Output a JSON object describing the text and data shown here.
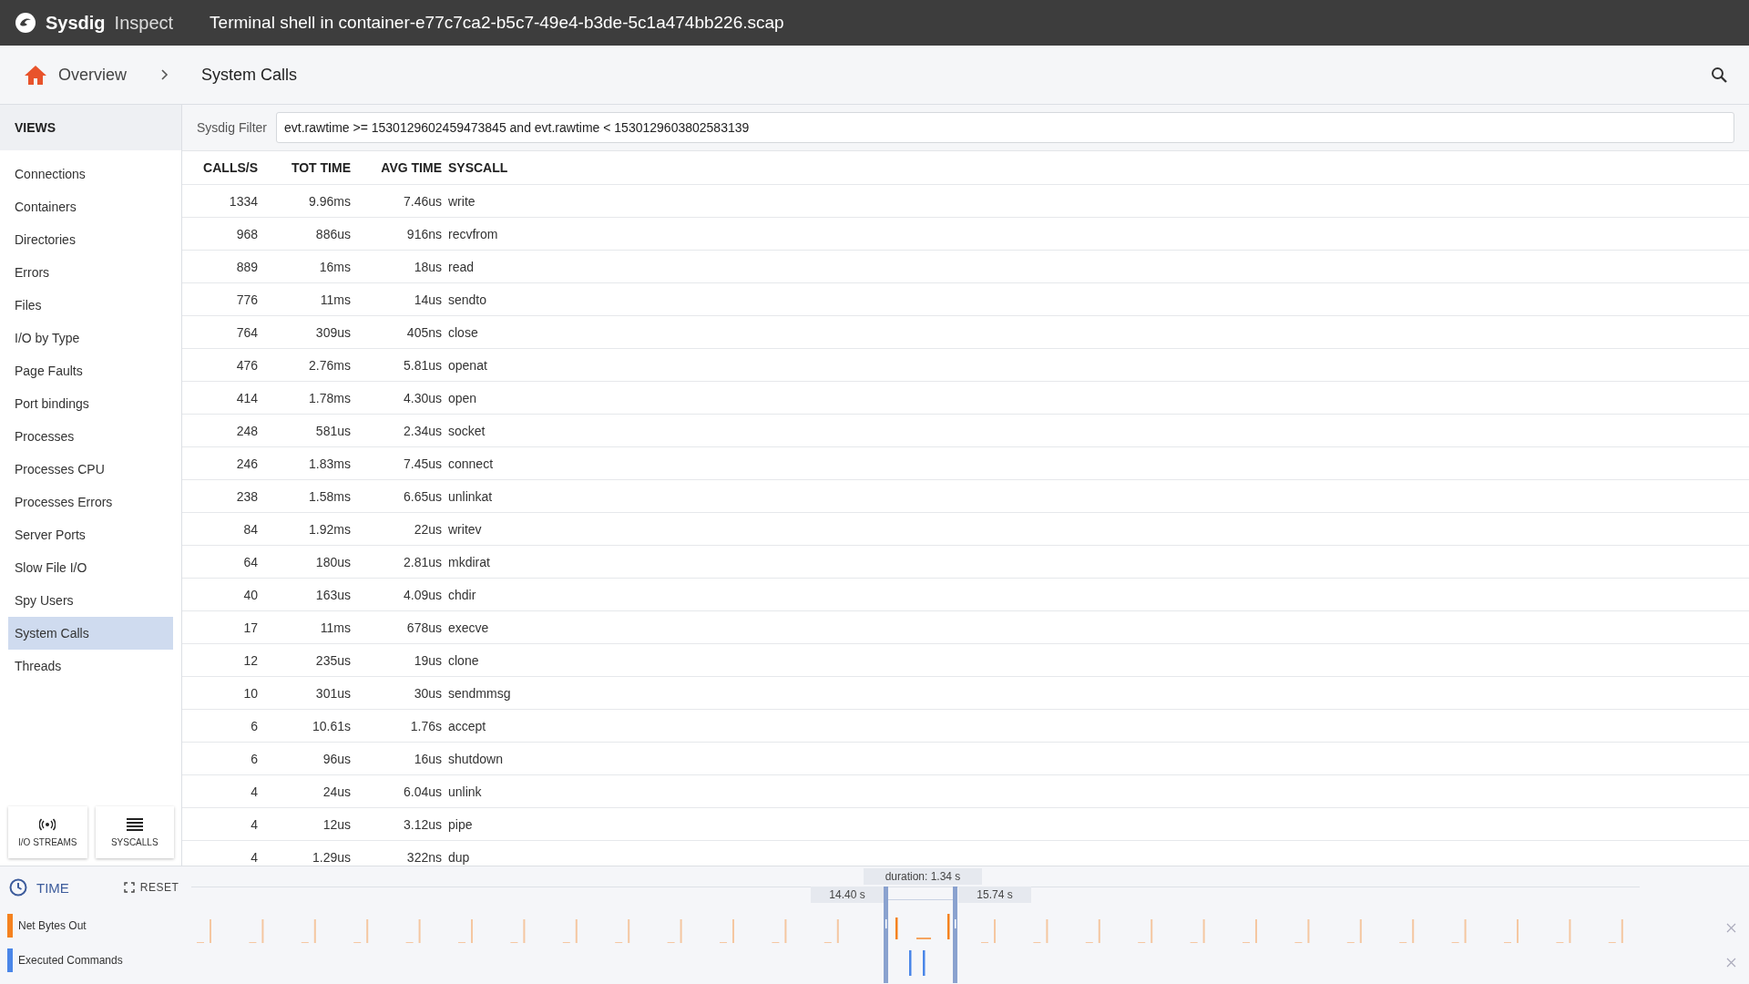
{
  "app": {
    "brand": "Sysdig",
    "product": "Inspect",
    "title": "Terminal shell in container-e77c7ca2-b5c7-49e4-b3de-5c1a474bb226.scap"
  },
  "breadcrumb": [
    "Overview",
    "System Calls"
  ],
  "sidebar": {
    "header": "VIEWS",
    "items": [
      {
        "label": "Connections",
        "selected": false
      },
      {
        "label": "Containers",
        "selected": false
      },
      {
        "label": "Directories",
        "selected": false
      },
      {
        "label": "Errors",
        "selected": false
      },
      {
        "label": "Files",
        "selected": false
      },
      {
        "label": "I/O by Type",
        "selected": false
      },
      {
        "label": "Page Faults",
        "selected": false
      },
      {
        "label": "Port bindings",
        "selected": false
      },
      {
        "label": "Processes",
        "selected": false
      },
      {
        "label": "Processes CPU",
        "selected": false
      },
      {
        "label": "Processes Errors",
        "selected": false
      },
      {
        "label": "Server Ports",
        "selected": false
      },
      {
        "label": "Slow File I/O",
        "selected": false
      },
      {
        "label": "Spy Users",
        "selected": false
      },
      {
        "label": "System Calls",
        "selected": true
      },
      {
        "label": "Threads",
        "selected": false
      }
    ],
    "buttons": [
      {
        "kind": "streams",
        "label": "I/O STREAMS"
      },
      {
        "kind": "syscalls",
        "label": "SYSCALLS"
      }
    ]
  },
  "filter": {
    "label": "Sysdig Filter",
    "value": "evt.rawtime >= 1530129602459473845 and evt.rawtime < 1530129603802583139"
  },
  "table": {
    "columns": [
      "CALLS/S",
      "TOT TIME",
      "AVG TIME",
      "SYSCALL"
    ],
    "rows": [
      [
        "1334",
        "9.96ms",
        "7.46us",
        "write"
      ],
      [
        "968",
        "886us",
        "916ns",
        "recvfrom"
      ],
      [
        "889",
        "16ms",
        "18us",
        "read"
      ],
      [
        "776",
        "11ms",
        "14us",
        "sendto"
      ],
      [
        "764",
        "309us",
        "405ns",
        "close"
      ],
      [
        "476",
        "2.76ms",
        "5.81us",
        "openat"
      ],
      [
        "414",
        "1.78ms",
        "4.30us",
        "open"
      ],
      [
        "248",
        "581us",
        "2.34us",
        "socket"
      ],
      [
        "246",
        "1.83ms",
        "7.45us",
        "connect"
      ],
      [
        "238",
        "1.58ms",
        "6.65us",
        "unlinkat"
      ],
      [
        "84",
        "1.92ms",
        "22us",
        "writev"
      ],
      [
        "64",
        "180us",
        "2.81us",
        "mkdirat"
      ],
      [
        "40",
        "163us",
        "4.09us",
        "chdir"
      ],
      [
        "17",
        "11ms",
        "678us",
        "execve"
      ],
      [
        "12",
        "235us",
        "19us",
        "clone"
      ],
      [
        "10",
        "301us",
        "30us",
        "sendmmsg"
      ],
      [
        "6",
        "10.61s",
        "1.76s",
        "accept"
      ],
      [
        "6",
        "96us",
        "16us",
        "shutdown"
      ],
      [
        "4",
        "24us",
        "6.04us",
        "unlink"
      ],
      [
        "4",
        "12us",
        "3.12us",
        "pipe"
      ],
      [
        "4",
        "1.29us",
        "322ns",
        "dup"
      ]
    ]
  },
  "timeline": {
    "title": "TIME",
    "reset": "RESET",
    "duration": "duration: 1.34 s",
    "start": "14.40 s",
    "end": "15.74 s",
    "tracks": [
      {
        "name": "Net Bytes Out",
        "color": "#f5821f"
      },
      {
        "name": "Executed Commands",
        "color": "#4a86e8"
      }
    ]
  }
}
